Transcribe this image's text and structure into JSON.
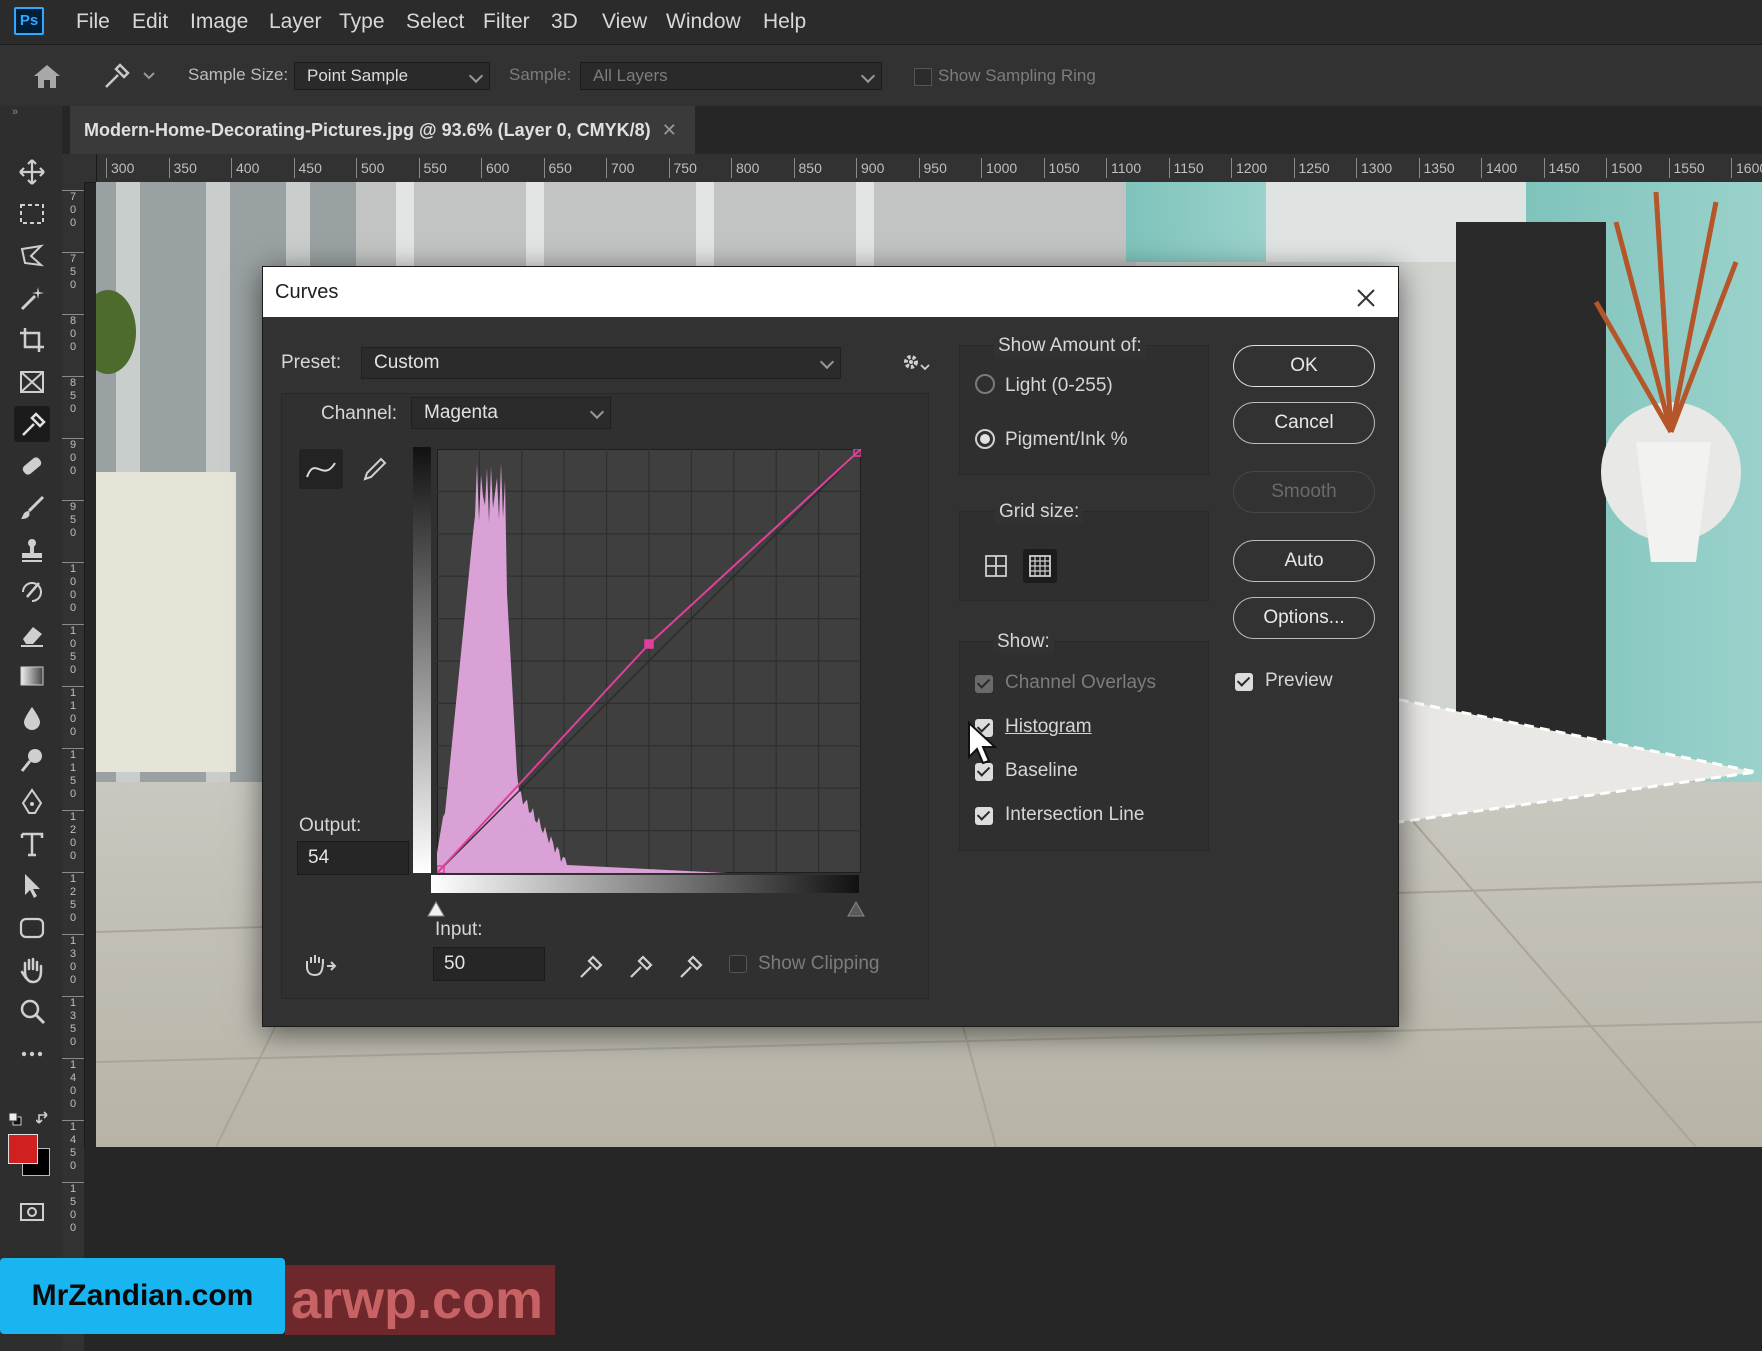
{
  "app": {
    "logo": "Ps",
    "menu": [
      "File",
      "Edit",
      "Image",
      "Layer",
      "Type",
      "Select",
      "Filter",
      "3D",
      "View",
      "Window",
      "Help"
    ]
  },
  "options_bar": {
    "sample_size_label": "Sample Size:",
    "sample_size_value": "Point Sample",
    "sample_label": "Sample:",
    "sample_value": "All Layers",
    "show_sampling_ring": "Show Sampling Ring"
  },
  "document": {
    "tab_title": "Modern-Home-Decorating-Pictures.jpg @ 93.6% (Layer 0, CMYK/8)"
  },
  "rulers": {
    "horizontal": [
      "300",
      "350",
      "400",
      "450",
      "500",
      "550",
      "600",
      "650",
      "700",
      "750",
      "800",
      "850",
      "900",
      "950",
      "1000",
      "1050",
      "1100",
      "1150",
      "1200",
      "1250",
      "1300",
      "1350",
      "1400",
      "1450",
      "1500",
      "1550",
      "1600"
    ],
    "vertical": [
      "700",
      "750",
      "800",
      "850",
      "900",
      "950",
      "1000",
      "1050",
      "1100",
      "1150",
      "1200",
      "1250",
      "1300",
      "1350",
      "1400",
      "1450",
      "1500"
    ]
  },
  "curves_dialog": {
    "title": "Curves",
    "preset_label": "Preset:",
    "preset_value": "Custom",
    "channel_label": "Channel:",
    "channel_value": "Magenta",
    "output_label": "Output:",
    "output_value": "54",
    "input_label": "Input:",
    "input_value": "50",
    "show_clipping": "Show Clipping",
    "show_amount_title": "Show Amount of:",
    "light_option": "Light  (0-255)",
    "pigment_option": "Pigment/Ink %",
    "grid_size_title": "Grid size:",
    "show_title": "Show:",
    "channel_overlays": "Channel Overlays",
    "histogram": "Histogram",
    "baseline": "Baseline",
    "intersection_line": "Intersection Line",
    "buttons": {
      "ok": "OK",
      "cancel": "Cancel",
      "smooth": "Smooth",
      "auto": "Auto",
      "options": "Options..."
    },
    "preview": "Preview",
    "curve_points": [
      {
        "input": 100,
        "output": 100
      },
      {
        "input": 50,
        "output": 54
      },
      {
        "input": 0,
        "output": 0
      }
    ],
    "colors": {
      "curve": "#e0409a",
      "histogram": "#e2a6de"
    }
  },
  "watermark": {
    "brand": "MrZandian.com",
    "partial": "arwp.com"
  }
}
